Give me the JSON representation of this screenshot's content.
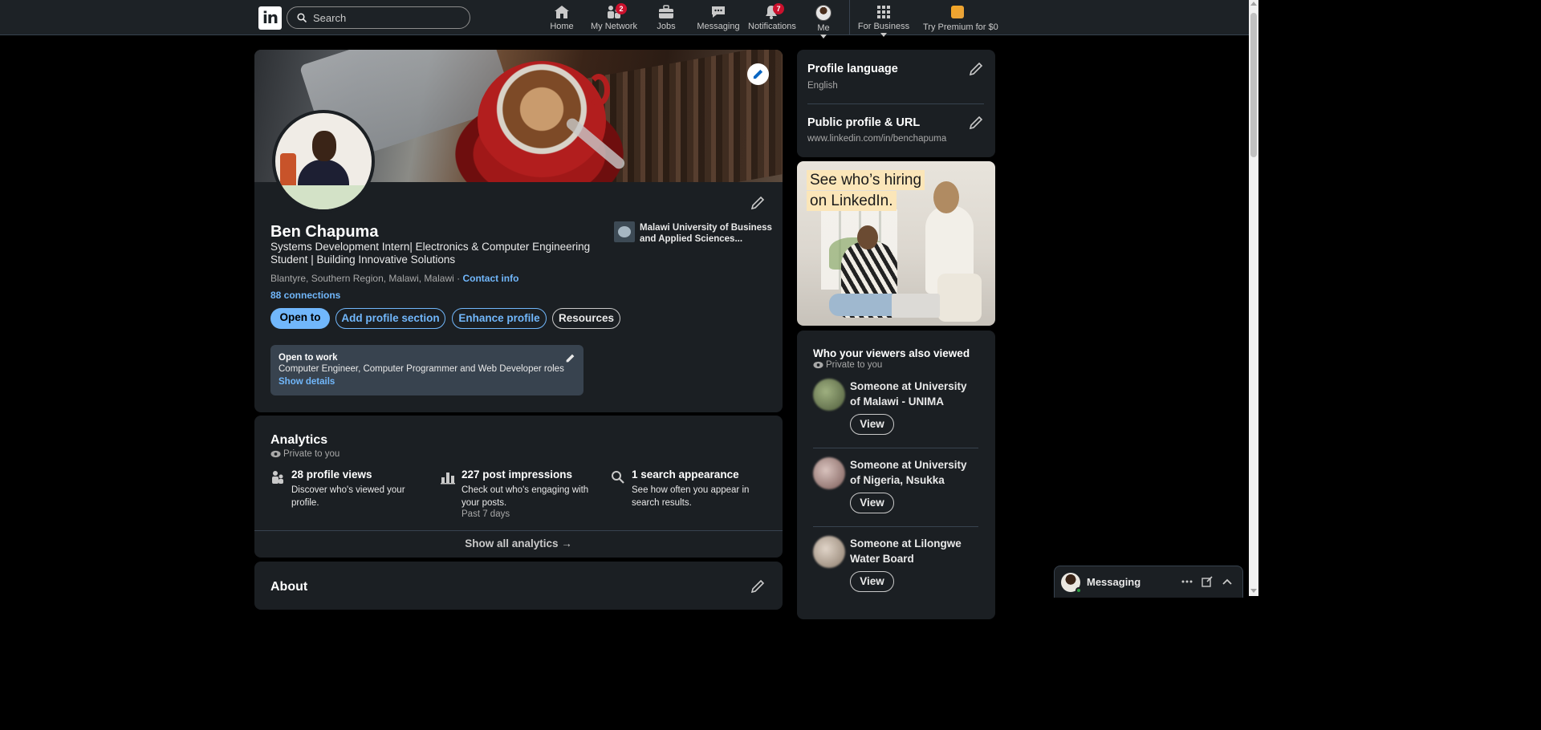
{
  "nav": {
    "logo": "in",
    "search_placeholder": "Search",
    "items": [
      {
        "label": "Home",
        "icon": "home-icon"
      },
      {
        "label": "My Network",
        "icon": "network-icon",
        "badge": "2"
      },
      {
        "label": "Jobs",
        "icon": "jobs-icon"
      },
      {
        "label": "Messaging",
        "icon": "messaging-icon"
      },
      {
        "label": "Notifications",
        "icon": "bell-icon",
        "badge": "7"
      },
      {
        "label": "Me",
        "icon": "avatar"
      },
      {
        "label": "For Business",
        "icon": "grid-icon"
      },
      {
        "label": "Try Premium for $0",
        "icon": "premium-icon"
      }
    ]
  },
  "profile": {
    "name": "Ben Chapuma",
    "headline": "Systems Development Intern| Electronics & Computer Engineering Student | Building Innovative Solutions",
    "location": "Blantyre, Southern Region, Malawi, Malawi",
    "location_sep": " · ",
    "contact_info": "Contact info",
    "connections": "88 connections",
    "education": "Malawi University of Business and Applied Sciences...",
    "buttons": {
      "open_to": "Open to",
      "add_section": "Add profile section",
      "enhance": "Enhance profile",
      "resources": "Resources"
    },
    "open_to_work": {
      "title": "Open to work",
      "roles": "Computer Engineer, Computer Programmer and Web Developer roles",
      "details": "Show details"
    }
  },
  "analytics": {
    "title": "Analytics",
    "private": "Private to you",
    "metrics": [
      {
        "title": "28 profile views",
        "desc": "Discover who's viewed your profile.",
        "period": ""
      },
      {
        "title": "227 post impressions",
        "desc": "Check out who's engaging with your posts.",
        "period": "Past 7 days"
      },
      {
        "title": "1 search appearance",
        "desc": "See how often you appear in search results.",
        "period": ""
      }
    ],
    "show_all": "Show all analytics →"
  },
  "about": {
    "title": "About"
  },
  "rail": {
    "lang_title": "Profile language",
    "lang_value": "English",
    "url_title": "Public profile & URL",
    "url_value": "www.linkedin.com/in/benchapuma",
    "ad_line1": "See who’s hiring",
    "ad_line2": "on LinkedIn.",
    "viewers_title": "Who your viewers also viewed",
    "viewers_private": "Private to you",
    "viewers": [
      {
        "name": "Someone at University of Malawi - UNIMA",
        "button": "View"
      },
      {
        "name": "Someone at University of Nigeria, Nsukka",
        "button": "View"
      },
      {
        "name": "Someone at Lilongwe Water Board",
        "button": "View"
      }
    ]
  },
  "messaging": {
    "label": "Messaging"
  },
  "colors": {
    "accent": "#71b7fb",
    "badge": "#cb112d",
    "card": "#1b1f23",
    "nav": "#1d2226"
  }
}
